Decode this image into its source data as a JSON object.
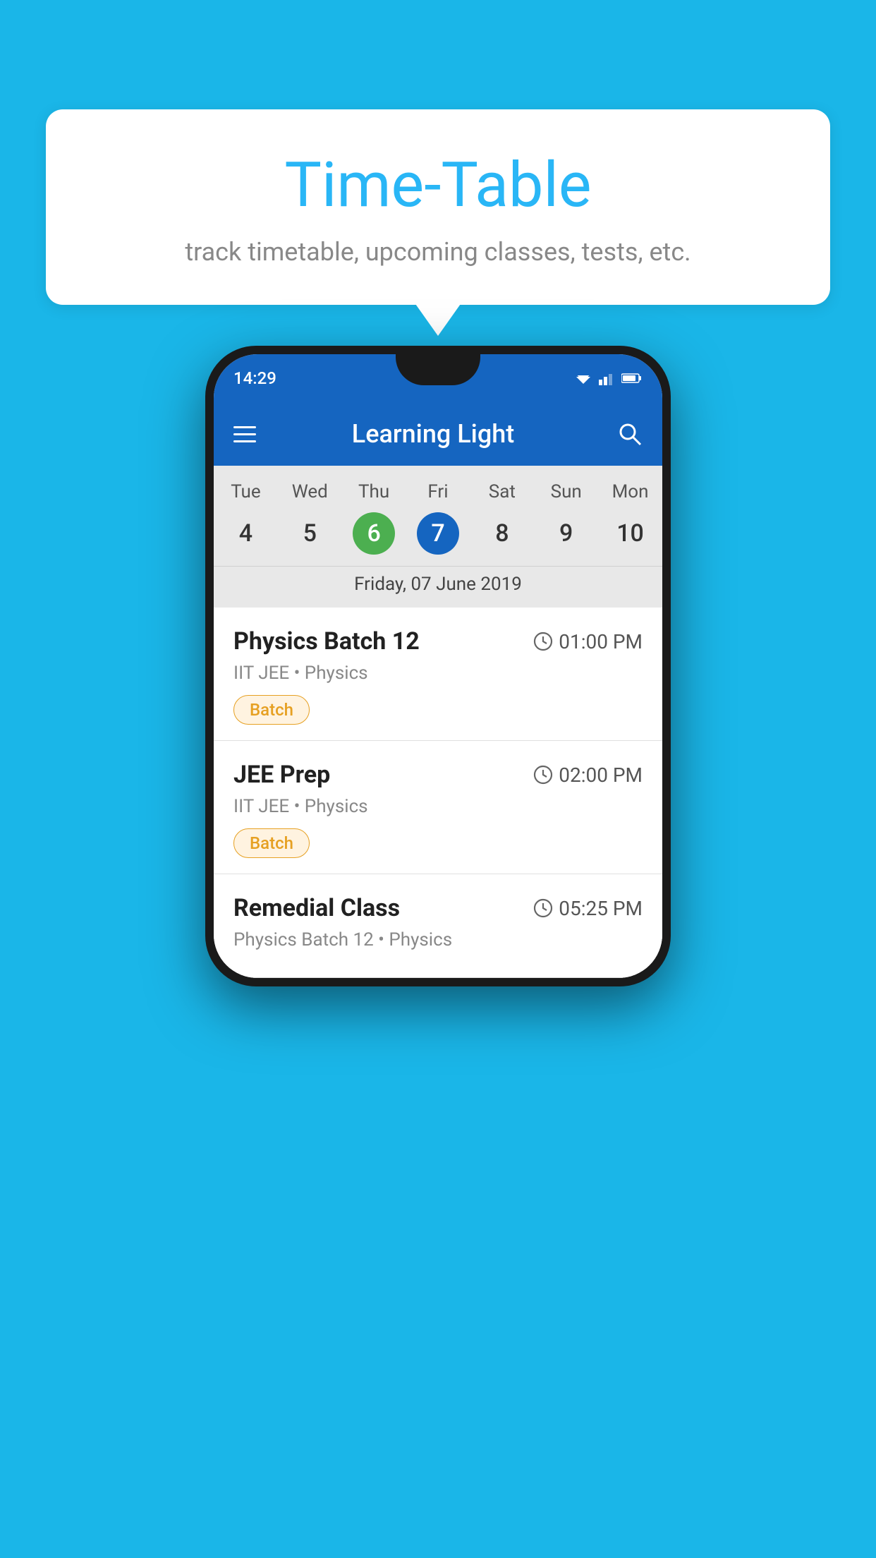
{
  "background_color": "#1ab6e8",
  "bubble": {
    "title": "Time-Table",
    "subtitle": "track timetable, upcoming classes, tests, etc."
  },
  "phone": {
    "status_bar": {
      "time": "14:29"
    },
    "app_bar": {
      "title": "Learning Light",
      "menu_label": "menu",
      "search_label": "search"
    },
    "calendar": {
      "days": [
        {
          "short": "Tue",
          "num": "4"
        },
        {
          "short": "Wed",
          "num": "5"
        },
        {
          "short": "Thu",
          "num": "6",
          "state": "today"
        },
        {
          "short": "Fri",
          "num": "7",
          "state": "selected"
        },
        {
          "short": "Sat",
          "num": "8"
        },
        {
          "short": "Sun",
          "num": "9"
        },
        {
          "short": "Mon",
          "num": "10"
        }
      ],
      "selected_date_label": "Friday, 07 June 2019"
    },
    "schedule": [
      {
        "title": "Physics Batch 12",
        "time": "01:00 PM",
        "subtitle": "IIT JEE • Physics",
        "badge": "Batch"
      },
      {
        "title": "JEE Prep",
        "time": "02:00 PM",
        "subtitle": "IIT JEE • Physics",
        "badge": "Batch"
      },
      {
        "title": "Remedial Class",
        "time": "05:25 PM",
        "subtitle": "Physics Batch 12 • Physics",
        "badge": null
      }
    ]
  }
}
